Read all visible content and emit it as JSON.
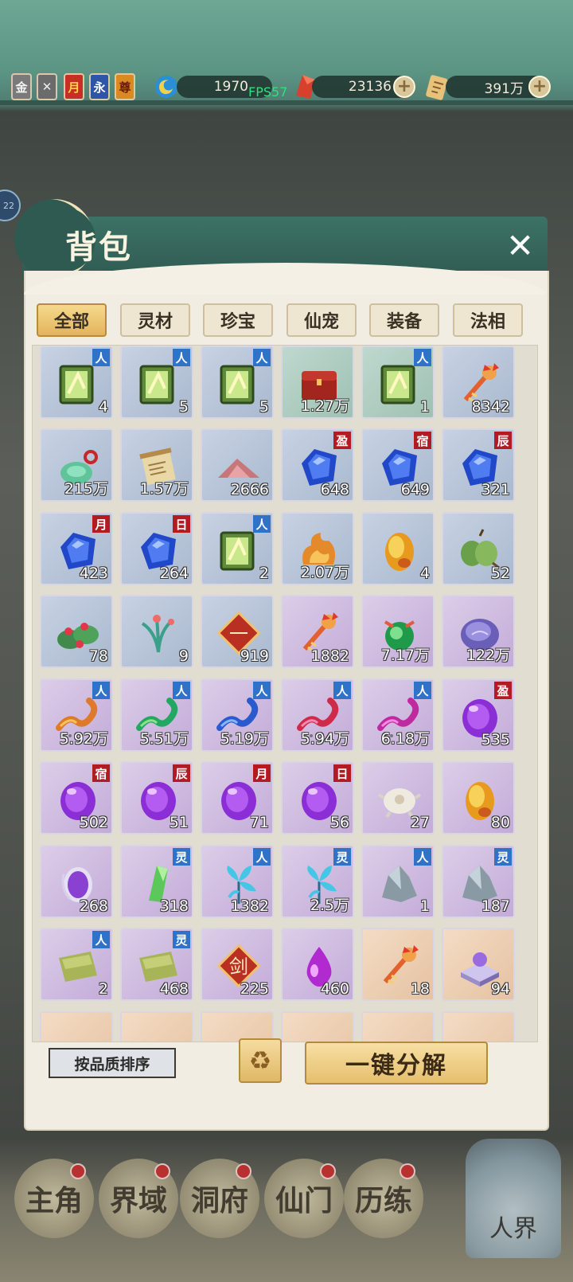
{
  "topbar": {
    "badges": [
      {
        "label": "金",
        "bg": "#7a7a7a",
        "color": "#f5f5f5"
      },
      {
        "label": "✕",
        "bg": "#6b6b6b",
        "color": "#ececec"
      },
      {
        "label": "月",
        "bg": "#c62f22",
        "color": "#ffd54a"
      },
      {
        "label": "永",
        "bg": "#2f55a8",
        "color": "#ffffff"
      },
      {
        "label": "尊",
        "bg": "#d98a20",
        "color": "#6a1c0c"
      }
    ],
    "resources": [
      {
        "name": "spirit-energy",
        "value": "1970"
      },
      {
        "name": "spirit-crystal",
        "value": "23136"
      },
      {
        "name": "scroll-currency",
        "value": "391万"
      }
    ],
    "fps": "FPS57",
    "plus_symbol": "+"
  },
  "side_badge": "22",
  "panel": {
    "title": "背包",
    "close_symbol": "✕",
    "tabs": [
      "全部",
      "灵材",
      "珍宝",
      "仙宠",
      "装备",
      "法相"
    ],
    "active_tab": 0
  },
  "items": [
    {
      "tag": "人",
      "tag_color": "blue",
      "qty": "4",
      "bg": "blue",
      "icon": "green-scroll-icon"
    },
    {
      "tag": "人",
      "tag_color": "blue",
      "qty": "5",
      "bg": "blue",
      "icon": "green-scroll-icon"
    },
    {
      "tag": "人",
      "tag_color": "blue",
      "qty": "5",
      "bg": "blue",
      "icon": "green-scroll-icon"
    },
    {
      "tag": "",
      "tag_color": "",
      "qty": "1.27万",
      "bg": "green",
      "icon": "red-chest-icon"
    },
    {
      "tag": "人",
      "tag_color": "blue",
      "qty": "1",
      "bg": "green",
      "icon": "green-scroll-icon"
    },
    {
      "tag": "",
      "tag_color": "",
      "qty": "8342",
      "bg": "blue",
      "icon": "fire-key-icon"
    },
    {
      "tag": "",
      "tag_color": "",
      "qty": "215万",
      "bg": "blue",
      "icon": "jade-pendant-icon"
    },
    {
      "tag": "",
      "tag_color": "",
      "qty": "1.57万",
      "bg": "blue",
      "icon": "paper-scroll-icon"
    },
    {
      "tag": "",
      "tag_color": "",
      "qty": "2666",
      "bg": "blue",
      "icon": "powder-pile-icon"
    },
    {
      "tag": "盈",
      "tag_color": "red",
      "qty": "648",
      "bg": "blue",
      "icon": "blue-gem-icon"
    },
    {
      "tag": "宿",
      "tag_color": "red",
      "qty": "649",
      "bg": "blue",
      "icon": "blue-gem-icon"
    },
    {
      "tag": "辰",
      "tag_color": "red",
      "qty": "321",
      "bg": "blue",
      "icon": "blue-gem-icon"
    },
    {
      "tag": "月",
      "tag_color": "red",
      "qty": "423",
      "bg": "blue",
      "icon": "blue-gem-icon"
    },
    {
      "tag": "日",
      "tag_color": "red",
      "qty": "264",
      "bg": "blue",
      "icon": "blue-gem-icon"
    },
    {
      "tag": "人",
      "tag_color": "blue",
      "qty": "2",
      "bg": "blue",
      "icon": "green-scroll-icon"
    },
    {
      "tag": "",
      "tag_color": "",
      "qty": "2.07万",
      "bg": "blue",
      "icon": "flame-ore-icon"
    },
    {
      "tag": "",
      "tag_color": "",
      "qty": "4",
      "bg": "blue",
      "icon": "golden-egg-icon"
    },
    {
      "tag": "",
      "tag_color": "",
      "qty": "52",
      "bg": "blue",
      "icon": "green-gourd-icon"
    },
    {
      "tag": "",
      "tag_color": "",
      "qty": "78",
      "bg": "blue",
      "icon": "red-flower-herb-icon"
    },
    {
      "tag": "",
      "tag_color": "",
      "qty": "9",
      "bg": "blue",
      "icon": "orchid-herb-icon"
    },
    {
      "tag": "",
      "tag_color": "",
      "qty": "919",
      "bg": "blue",
      "icon": "rune-tile-icon",
      "glyph": "一"
    },
    {
      "tag": "",
      "tag_color": "",
      "qty": "1882",
      "bg": "purple",
      "icon": "fire-key-icon"
    },
    {
      "tag": "",
      "tag_color": "",
      "qty": "7.17万",
      "bg": "purple",
      "icon": "green-orb-icon"
    },
    {
      "tag": "",
      "tag_color": "",
      "qty": "122万",
      "bg": "purple",
      "icon": "violet-stone-icon"
    },
    {
      "tag": "人",
      "tag_color": "blue",
      "qty": "5.92万",
      "bg": "purple",
      "icon": "orange-dragon-icon"
    },
    {
      "tag": "人",
      "tag_color": "blue",
      "qty": "5.51万",
      "bg": "purple",
      "icon": "green-dragon-icon"
    },
    {
      "tag": "人",
      "tag_color": "blue",
      "qty": "5.19万",
      "bg": "purple",
      "icon": "blue-dragon-icon"
    },
    {
      "tag": "人",
      "tag_color": "blue",
      "qty": "5.94万",
      "bg": "purple",
      "icon": "red-dragon-icon"
    },
    {
      "tag": "人",
      "tag_color": "blue",
      "qty": "6.18万",
      "bg": "purple",
      "icon": "pink-dragon-icon"
    },
    {
      "tag": "盈",
      "tag_color": "red",
      "qty": "535",
      "bg": "purple",
      "icon": "purple-gem-icon"
    },
    {
      "tag": "宿",
      "tag_color": "red",
      "qty": "502",
      "bg": "purple",
      "icon": "purple-gem-icon"
    },
    {
      "tag": "辰",
      "tag_color": "red",
      "qty": "51",
      "bg": "purple",
      "icon": "purple-gem-icon"
    },
    {
      "tag": "月",
      "tag_color": "red",
      "qty": "71",
      "bg": "purple",
      "icon": "purple-gem-icon"
    },
    {
      "tag": "日",
      "tag_color": "red",
      "qty": "56",
      "bg": "purple",
      "icon": "purple-gem-icon"
    },
    {
      "tag": "",
      "tag_color": "",
      "qty": "27",
      "bg": "purple",
      "icon": "white-fur-icon"
    },
    {
      "tag": "",
      "tag_color": "",
      "qty": "80",
      "bg": "purple",
      "icon": "golden-egg-icon"
    },
    {
      "tag": "",
      "tag_color": "",
      "qty": "268",
      "bg": "purple",
      "icon": "violet-amulet-icon"
    },
    {
      "tag": "灵",
      "tag_color": "blue",
      "qty": "318",
      "bg": "purple",
      "icon": "green-crystal-icon"
    },
    {
      "tag": "人",
      "tag_color": "blue",
      "qty": "1382",
      "bg": "purple",
      "icon": "cyan-flower-icon"
    },
    {
      "tag": "灵",
      "tag_color": "blue",
      "qty": "2.5万",
      "bg": "purple",
      "icon": "cyan-flower-icon"
    },
    {
      "tag": "人",
      "tag_color": "blue",
      "qty": "1",
      "bg": "purple",
      "icon": "grey-ore-icon"
    },
    {
      "tag": "灵",
      "tag_color": "blue",
      "qty": "187",
      "bg": "purple",
      "icon": "grey-ore-icon"
    },
    {
      "tag": "人",
      "tag_color": "blue",
      "qty": "2",
      "bg": "purple",
      "icon": "cloth-scrap-icon"
    },
    {
      "tag": "灵",
      "tag_color": "blue",
      "qty": "468",
      "bg": "purple",
      "icon": "cloth-scrap-icon"
    },
    {
      "tag": "",
      "tag_color": "",
      "qty": "225",
      "bg": "purple",
      "icon": "rune-tile-icon",
      "glyph": "剑"
    },
    {
      "tag": "",
      "tag_color": "",
      "qty": "460",
      "bg": "purple",
      "icon": "purple-drop-icon"
    },
    {
      "tag": "",
      "tag_color": "",
      "qty": "18",
      "bg": "orange",
      "icon": "fire-key-icon"
    },
    {
      "tag": "",
      "tag_color": "",
      "qty": "94",
      "bg": "orange",
      "icon": "pedestal-orb-icon"
    }
  ],
  "footer": {
    "sort_label": "按品质排序",
    "recycle_symbol": "♻",
    "decompose_label": "一键分解"
  },
  "bottom_nav": [
    {
      "label": "主角"
    },
    {
      "label": "界域"
    },
    {
      "label": "洞府"
    },
    {
      "label": "仙门"
    },
    {
      "label": "历练"
    }
  ],
  "realm_label": "人界"
}
